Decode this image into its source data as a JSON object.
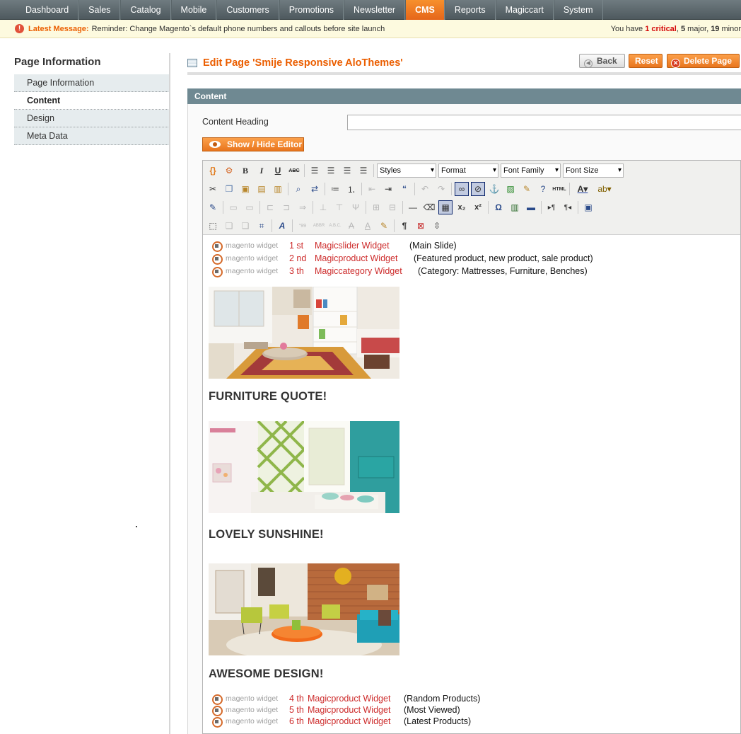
{
  "nav": {
    "items": [
      "Dashboard",
      "Sales",
      "Catalog",
      "Mobile",
      "Customers",
      "Promotions",
      "Newsletter",
      "CMS",
      "Reports",
      "Magiccart",
      "System"
    ],
    "active": "CMS"
  },
  "message": {
    "label": "Latest Message:",
    "text": "Reminder: Change Magento`s default phone numbers and callouts before site launch",
    "summary_prefix": "You have ",
    "critical_count": "1 critical",
    "sep1": ", ",
    "major_count": "5",
    "major_text": " major, ",
    "minor_count": "19",
    "minor_text": " minor"
  },
  "sidebar": {
    "title": "Page Information",
    "items": [
      {
        "label": "Page Information",
        "active": false
      },
      {
        "label": "Content",
        "active": true
      },
      {
        "label": "Design",
        "active": false
      },
      {
        "label": "Meta Data",
        "active": false
      }
    ]
  },
  "header": {
    "title": "Edit Page 'Smije Responsive AloThemes'",
    "back_label": "Back",
    "reset_label": "Reset",
    "delete_label": "Delete Page"
  },
  "content": {
    "section_title": "Content",
    "heading_label": "Content Heading",
    "heading_value": "",
    "toggle_editor_label": "Show / Hide Editor"
  },
  "toolbar": {
    "styles": "Styles",
    "format": "Format",
    "font_family": "Font Family",
    "font_size": "Font Size"
  },
  "editor": {
    "widget_tag": "magento widget",
    "widgets_top": [
      {
        "num": "1 st",
        "name": "Magicslider Widget",
        "note": "(Main Slide)"
      },
      {
        "num": "2 nd",
        "name": "Magicproduct Widget",
        "note": "(Featured product, new product, sale product)"
      },
      {
        "num": "3 th",
        "name": "Magiccategory Widget",
        "note": "(Category: Mattresses, Furniture, Benches)"
      }
    ],
    "headings": [
      "FURNITURE QUOTE!",
      "LOVELY SUNSHINE!",
      "AWESOME DESIGN!"
    ],
    "widgets_bottom": [
      {
        "num": "4 th",
        "name": "Magicproduct Widget",
        "note": "(Random Products)"
      },
      {
        "num": "5 th",
        "name": "Magicproduct Widget",
        "note": "(Most Viewed)"
      },
      {
        "num": "6 th",
        "name": "Magicproduct Widget",
        "note": "(Latest Products)"
      }
    ]
  },
  "colors": {
    "accent": "#eb5e00",
    "nav_active": "#f08228",
    "widget_red": "#cd2b2b"
  }
}
